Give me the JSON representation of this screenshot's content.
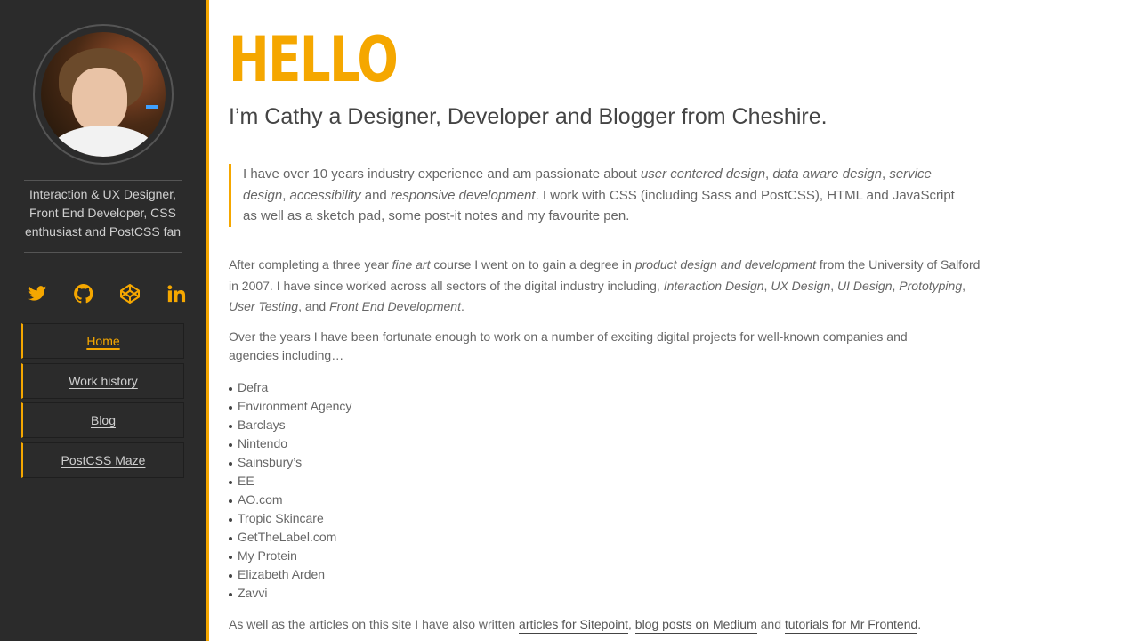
{
  "sidebar": {
    "tagline": "Interaction & UX Designer, Front End Developer, CSS enthusiast and PostCSS fan",
    "socials": [
      {
        "icon": "twitter-icon"
      },
      {
        "icon": "github-icon"
      },
      {
        "icon": "codepen-icon"
      },
      {
        "icon": "linkedin-icon"
      }
    ],
    "nav": [
      {
        "label": "Home",
        "active": true
      },
      {
        "label": "Work history"
      },
      {
        "label": "Blog"
      },
      {
        "label": "PostCSS Maze"
      }
    ]
  },
  "main": {
    "heading": "HELLO",
    "intro": "I’m Cathy a Designer, Developer and Blogger from Cheshire.",
    "quote": {
      "t1": "I have over 10 years industry experience and am passionate about ",
      "e1": "user centered design",
      "t2": ", ",
      "e2": "data aware design",
      "t3": ", ",
      "e3": "service design",
      "t4": ", ",
      "e4": "accessibility",
      "t5": " and ",
      "e5": "responsive development",
      "t6": ". I work with CSS (including Sass and PostCSS), HTML and JavaScript as well as a sketch pad, some post-it notes and my favourite pen."
    },
    "para1": {
      "t1": "After completing a three year ",
      "e1": "fine art",
      "t2": " course I went on to gain a degree in ",
      "e2": "product design and development",
      "t3": " from the University of Salford in 2007. I have since worked across all sectors of the digital industry including, ",
      "e3": "Interaction Design",
      "t4": ", ",
      "e4": "UX Design",
      "t5": ", ",
      "e5": "UI Design",
      "t6": ", ",
      "e6": "Prototyping",
      "t7": ", ",
      "e7": "User Testing",
      "t8": ", and ",
      "e8": "Front End Development",
      "t9": "."
    },
    "para2": "Over the years I have been fortunate enough to work on a number of exciting digital projects for well-known companies and agencies including…",
    "companies": [
      "Defra",
      "Environment Agency",
      "Barclays",
      "Nintendo",
      "Sainsbury’s",
      "EE",
      "AO.com",
      "Tropic Skincare",
      "GetTheLabel.com",
      "My Protein",
      "Elizabeth Arden",
      "Zavvi"
    ],
    "para3": {
      "t1": "As well as the articles on this site I have also written ",
      "l1": "articles for Sitepoint",
      "t2": ", ",
      "l2": "blog posts on Medium",
      "t3": " and ",
      "l3": "tutorials for Mr Frontend",
      "t4": "."
    }
  },
  "colors": {
    "accent": "#f5a700",
    "sidebar_bg": "#2b2b2b"
  }
}
